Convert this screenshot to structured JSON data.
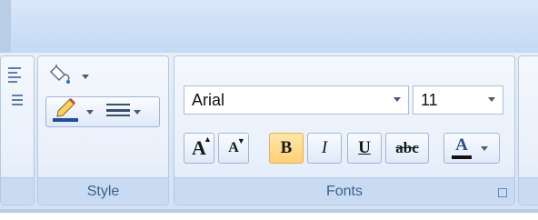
{
  "ribbon": {
    "groups": {
      "style": {
        "label": "Style"
      },
      "fonts": {
        "label": "Fonts"
      }
    },
    "style_group": {
      "fill_icon": "paint-bucket-icon",
      "line_color_icon": "pencil-line-color-icon",
      "line_style_icon": "line-style-icon",
      "line_color": "#1f4e9a"
    },
    "fonts_group": {
      "font_name": "Arial",
      "font_size": "11",
      "grow_font_label": "A",
      "shrink_font_label": "A",
      "bold_label": "B",
      "italic_label": "I",
      "underline_label": "U",
      "strikethrough_label": "abc",
      "font_color_label": "A",
      "font_color": "#111111",
      "bold_active": true
    }
  }
}
